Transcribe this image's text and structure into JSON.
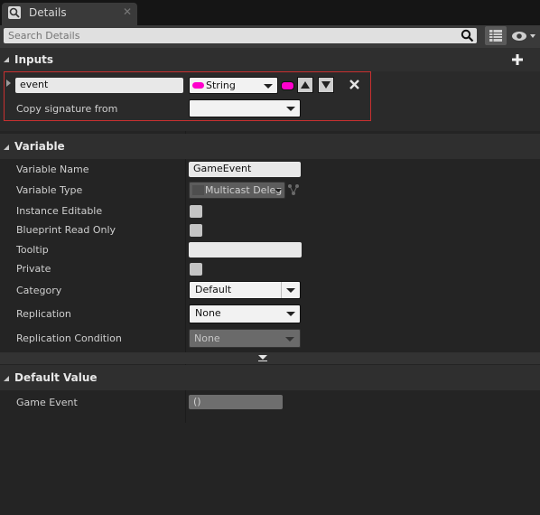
{
  "tab": {
    "title": "Details"
  },
  "search": {
    "placeholder": "Search Details"
  },
  "inputs": {
    "header": "Inputs",
    "param_name": "event",
    "param_type": "String",
    "copy_signature_label": "Copy signature from",
    "copy_signature_value": ""
  },
  "variable": {
    "header": "Variable",
    "rows": {
      "name_label": "Variable Name",
      "name_value": "GameEvent",
      "type_label": "Variable Type",
      "type_value": "Multicast Deleg",
      "instance_editable_label": "Instance Editable",
      "bp_read_only_label": "Blueprint Read Only",
      "tooltip_label": "Tooltip",
      "tooltip_value": "",
      "private_label": "Private",
      "category_label": "Category",
      "category_value": "Default",
      "replication_label": "Replication",
      "replication_value": "None",
      "replication_condition_label": "Replication Condition",
      "replication_condition_value": "None"
    }
  },
  "default_value": {
    "header": "Default Value",
    "game_event_label": "Game Event",
    "game_event_value": "()"
  },
  "colors": {
    "string_pin": "#ff00cc",
    "highlight": "#c83030"
  }
}
